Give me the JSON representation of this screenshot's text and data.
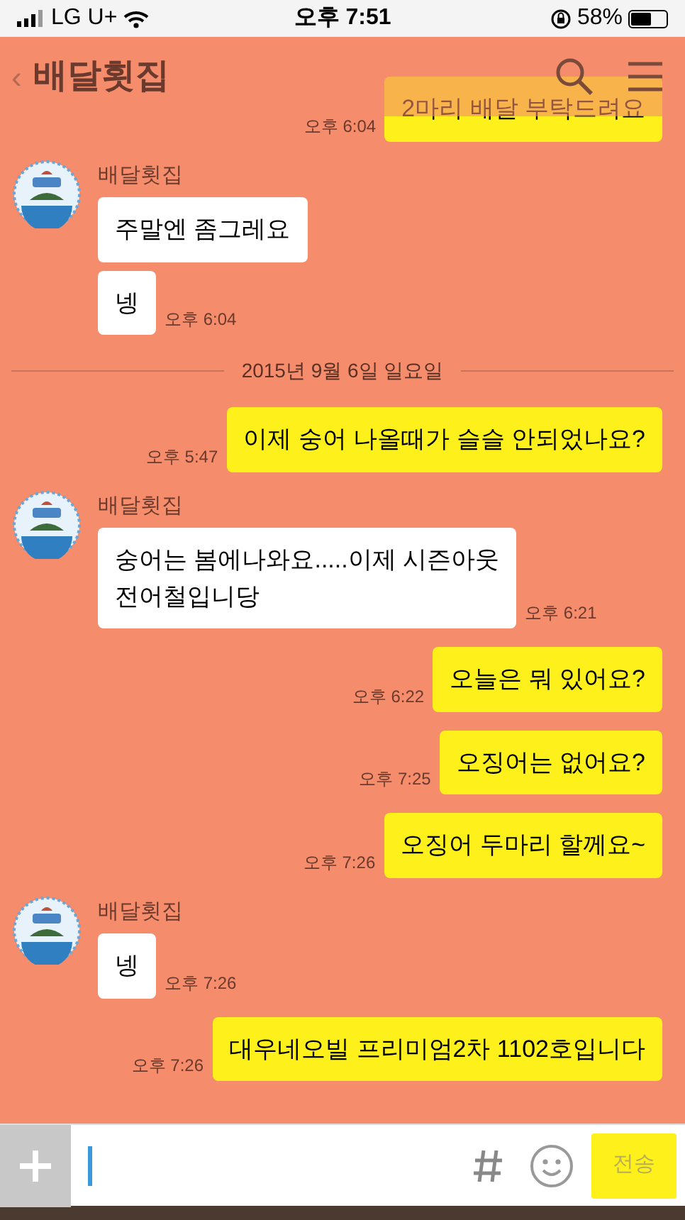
{
  "status_bar": {
    "carrier": "LG U+",
    "time": "오후 7:51",
    "battery": "58%"
  },
  "header": {
    "back": "‹",
    "title": "배달횟집"
  },
  "messages": [
    {
      "kind": "sent",
      "text": "2마리 배달 부탁드려요",
      "time": "오후 6:04"
    },
    {
      "kind": "received",
      "sender": "배달횟집",
      "bubbles": [
        {
          "text": "주말엔 좀그레요"
        },
        {
          "text": "넹",
          "time": "오후 6:04"
        }
      ]
    },
    {
      "kind": "date",
      "text": "2015년 9월 6일 일요일"
    },
    {
      "kind": "sent",
      "text": "이제 숭어 나올때가 슬슬 안되었나요?",
      "time": "오후 5:47"
    },
    {
      "kind": "received",
      "sender": "배달횟집",
      "bubbles": [
        {
          "text": "숭어는 봄에나와요.....이제 시즌아웃\n전어철입니당",
          "time": "오후 6:21"
        }
      ]
    },
    {
      "kind": "sent",
      "text": "오늘은 뭐 있어요?",
      "time": "오후 6:22"
    },
    {
      "kind": "sent",
      "text": "오징어는 없어요?",
      "time": "오후 7:25"
    },
    {
      "kind": "sent",
      "text": "오징어 두마리 할께요~",
      "time": "오후 7:26"
    },
    {
      "kind": "received",
      "sender": "배달횟집",
      "bubbles": [
        {
          "text": "넹",
          "time": "오후 7:26"
        }
      ]
    },
    {
      "kind": "sent",
      "text": "대우네오빌 프리미엄2차 1102호입니다",
      "time": "오후 7:26"
    }
  ],
  "composer": {
    "send": "전송"
  }
}
